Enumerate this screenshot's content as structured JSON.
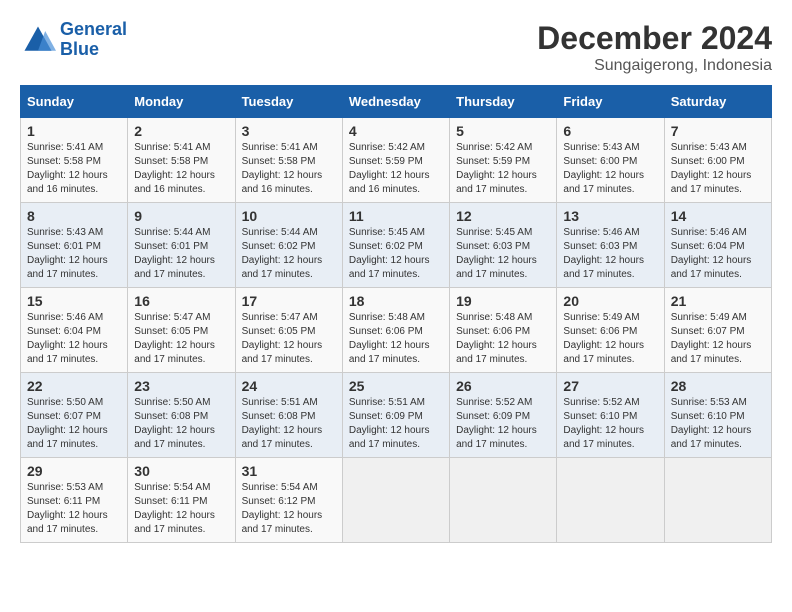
{
  "logo": {
    "line1": "General",
    "line2": "Blue"
  },
  "title": "December 2024",
  "subtitle": "Sungaigerong, Indonesia",
  "weekdays": [
    "Sunday",
    "Monday",
    "Tuesday",
    "Wednesday",
    "Thursday",
    "Friday",
    "Saturday"
  ],
  "weeks": [
    [
      {
        "day": "1",
        "sunrise": "5:41 AM",
        "sunset": "5:58 PM",
        "daylight": "12 hours and 16 minutes."
      },
      {
        "day": "2",
        "sunrise": "5:41 AM",
        "sunset": "5:58 PM",
        "daylight": "12 hours and 16 minutes."
      },
      {
        "day": "3",
        "sunrise": "5:41 AM",
        "sunset": "5:58 PM",
        "daylight": "12 hours and 16 minutes."
      },
      {
        "day": "4",
        "sunrise": "5:42 AM",
        "sunset": "5:59 PM",
        "daylight": "12 hours and 16 minutes."
      },
      {
        "day": "5",
        "sunrise": "5:42 AM",
        "sunset": "5:59 PM",
        "daylight": "12 hours and 17 minutes."
      },
      {
        "day": "6",
        "sunrise": "5:43 AM",
        "sunset": "6:00 PM",
        "daylight": "12 hours and 17 minutes."
      },
      {
        "day": "7",
        "sunrise": "5:43 AM",
        "sunset": "6:00 PM",
        "daylight": "12 hours and 17 minutes."
      }
    ],
    [
      {
        "day": "8",
        "sunrise": "5:43 AM",
        "sunset": "6:01 PM",
        "daylight": "12 hours and 17 minutes."
      },
      {
        "day": "9",
        "sunrise": "5:44 AM",
        "sunset": "6:01 PM",
        "daylight": "12 hours and 17 minutes."
      },
      {
        "day": "10",
        "sunrise": "5:44 AM",
        "sunset": "6:02 PM",
        "daylight": "12 hours and 17 minutes."
      },
      {
        "day": "11",
        "sunrise": "5:45 AM",
        "sunset": "6:02 PM",
        "daylight": "12 hours and 17 minutes."
      },
      {
        "day": "12",
        "sunrise": "5:45 AM",
        "sunset": "6:03 PM",
        "daylight": "12 hours and 17 minutes."
      },
      {
        "day": "13",
        "sunrise": "5:46 AM",
        "sunset": "6:03 PM",
        "daylight": "12 hours and 17 minutes."
      },
      {
        "day": "14",
        "sunrise": "5:46 AM",
        "sunset": "6:04 PM",
        "daylight": "12 hours and 17 minutes."
      }
    ],
    [
      {
        "day": "15",
        "sunrise": "5:46 AM",
        "sunset": "6:04 PM",
        "daylight": "12 hours and 17 minutes."
      },
      {
        "day": "16",
        "sunrise": "5:47 AM",
        "sunset": "6:05 PM",
        "daylight": "12 hours and 17 minutes."
      },
      {
        "day": "17",
        "sunrise": "5:47 AM",
        "sunset": "6:05 PM",
        "daylight": "12 hours and 17 minutes."
      },
      {
        "day": "18",
        "sunrise": "5:48 AM",
        "sunset": "6:06 PM",
        "daylight": "12 hours and 17 minutes."
      },
      {
        "day": "19",
        "sunrise": "5:48 AM",
        "sunset": "6:06 PM",
        "daylight": "12 hours and 17 minutes."
      },
      {
        "day": "20",
        "sunrise": "5:49 AM",
        "sunset": "6:06 PM",
        "daylight": "12 hours and 17 minutes."
      },
      {
        "day": "21",
        "sunrise": "5:49 AM",
        "sunset": "6:07 PM",
        "daylight": "12 hours and 17 minutes."
      }
    ],
    [
      {
        "day": "22",
        "sunrise": "5:50 AM",
        "sunset": "6:07 PM",
        "daylight": "12 hours and 17 minutes."
      },
      {
        "day": "23",
        "sunrise": "5:50 AM",
        "sunset": "6:08 PM",
        "daylight": "12 hours and 17 minutes."
      },
      {
        "day": "24",
        "sunrise": "5:51 AM",
        "sunset": "6:08 PM",
        "daylight": "12 hours and 17 minutes."
      },
      {
        "day": "25",
        "sunrise": "5:51 AM",
        "sunset": "6:09 PM",
        "daylight": "12 hours and 17 minutes."
      },
      {
        "day": "26",
        "sunrise": "5:52 AM",
        "sunset": "6:09 PM",
        "daylight": "12 hours and 17 minutes."
      },
      {
        "day": "27",
        "sunrise": "5:52 AM",
        "sunset": "6:10 PM",
        "daylight": "12 hours and 17 minutes."
      },
      {
        "day": "28",
        "sunrise": "5:53 AM",
        "sunset": "6:10 PM",
        "daylight": "12 hours and 17 minutes."
      }
    ],
    [
      {
        "day": "29",
        "sunrise": "5:53 AM",
        "sunset": "6:11 PM",
        "daylight": "12 hours and 17 minutes."
      },
      {
        "day": "30",
        "sunrise": "5:54 AM",
        "sunset": "6:11 PM",
        "daylight": "12 hours and 17 minutes."
      },
      {
        "day": "31",
        "sunrise": "5:54 AM",
        "sunset": "6:12 PM",
        "daylight": "12 hours and 17 minutes."
      },
      null,
      null,
      null,
      null
    ]
  ]
}
